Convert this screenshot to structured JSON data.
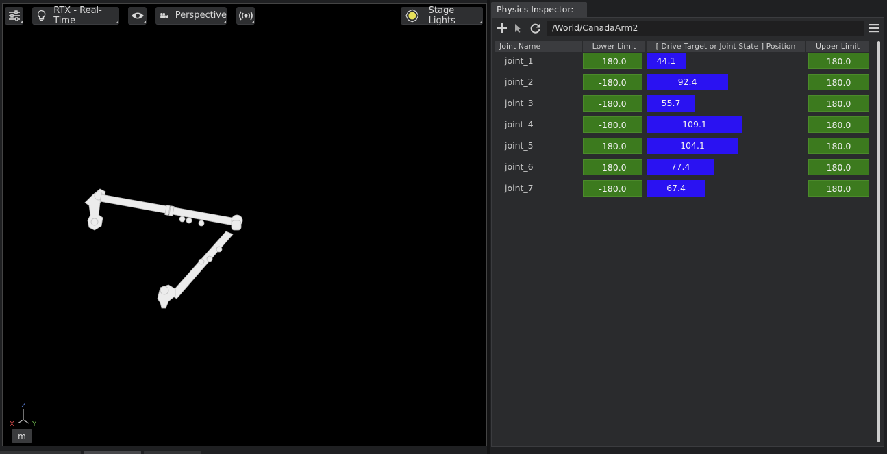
{
  "viewport": {
    "renderer_label": "RTX - Real-Time",
    "camera_label": "Perspective",
    "lights_label": "Stage Lights",
    "axes": {
      "z": "Z",
      "x": "X",
      "y": "Y"
    },
    "unit_label": "m",
    "colors": {
      "axis_x": "#d04a4a",
      "axis_y": "#6ab04c",
      "axis_z": "#5b7fd6",
      "model": "#e8e8e8"
    }
  },
  "inspector": {
    "tab_title": "Physics Inspector:",
    "prim_path": "/World/CanadaArm2",
    "columns": [
      "Joint Name",
      "Lower Limit",
      "[ Drive Target or Joint State ] Position",
      "Upper Limit"
    ],
    "joints": [
      {
        "name": "joint_1",
        "lower": "-180.0",
        "position": "44.1",
        "upper": "180.0",
        "value": 44.1
      },
      {
        "name": "joint_2",
        "lower": "-180.0",
        "position": "92.4",
        "upper": "180.0",
        "value": 92.4
      },
      {
        "name": "joint_3",
        "lower": "-180.0",
        "position": "55.7",
        "upper": "180.0",
        "value": 55.7
      },
      {
        "name": "joint_4",
        "lower": "-180.0",
        "position": "109.1",
        "upper": "180.0",
        "value": 109.1
      },
      {
        "name": "joint_5",
        "lower": "-180.0",
        "position": "104.1",
        "upper": "180.0",
        "value": 104.1
      },
      {
        "name": "joint_6",
        "lower": "-180.0",
        "position": "77.4",
        "upper": "180.0",
        "value": 77.4
      },
      {
        "name": "joint_7",
        "lower": "-180.0",
        "position": "67.4",
        "upper": "180.0",
        "value": 67.4
      }
    ],
    "colors": {
      "limit_bg": "#3c7a1e",
      "position_fill": "#2a12f2"
    }
  }
}
